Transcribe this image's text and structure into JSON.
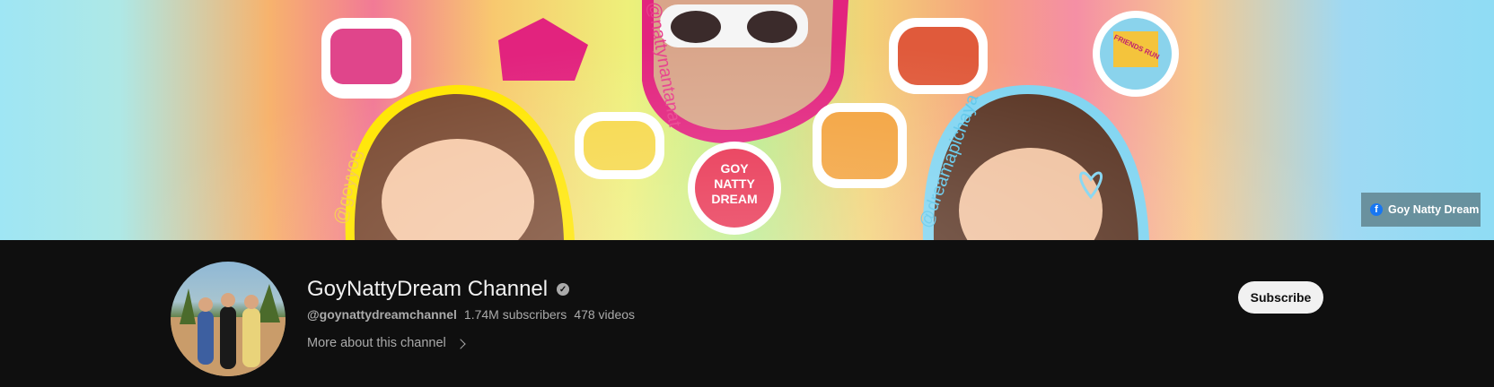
{
  "banner": {
    "handles": [
      "@goyyog",
      "@nattynantanat",
      "@dreamapichaya"
    ],
    "sticker_texts": [
      "GOY NATTY DREAM",
      "FRIENDS RUN"
    ],
    "facebook_link": {
      "label": "Goy Natty Dream",
      "icon": "facebook-icon"
    }
  },
  "channel": {
    "name": "GoyNattyDream Channel",
    "verified_icon": "verified-check-icon",
    "handle": "@goynattydreamchannel",
    "subscribers": "1.74M subscribers",
    "videos": "478 videos",
    "more_label": "More about this channel",
    "subscribe_label": "Subscribe"
  },
  "colors": {
    "background": "#0f0f0f",
    "text_primary": "#f1f1f1",
    "text_secondary": "#aaaaaa",
    "subscribe_bg": "#f1f1f1"
  }
}
